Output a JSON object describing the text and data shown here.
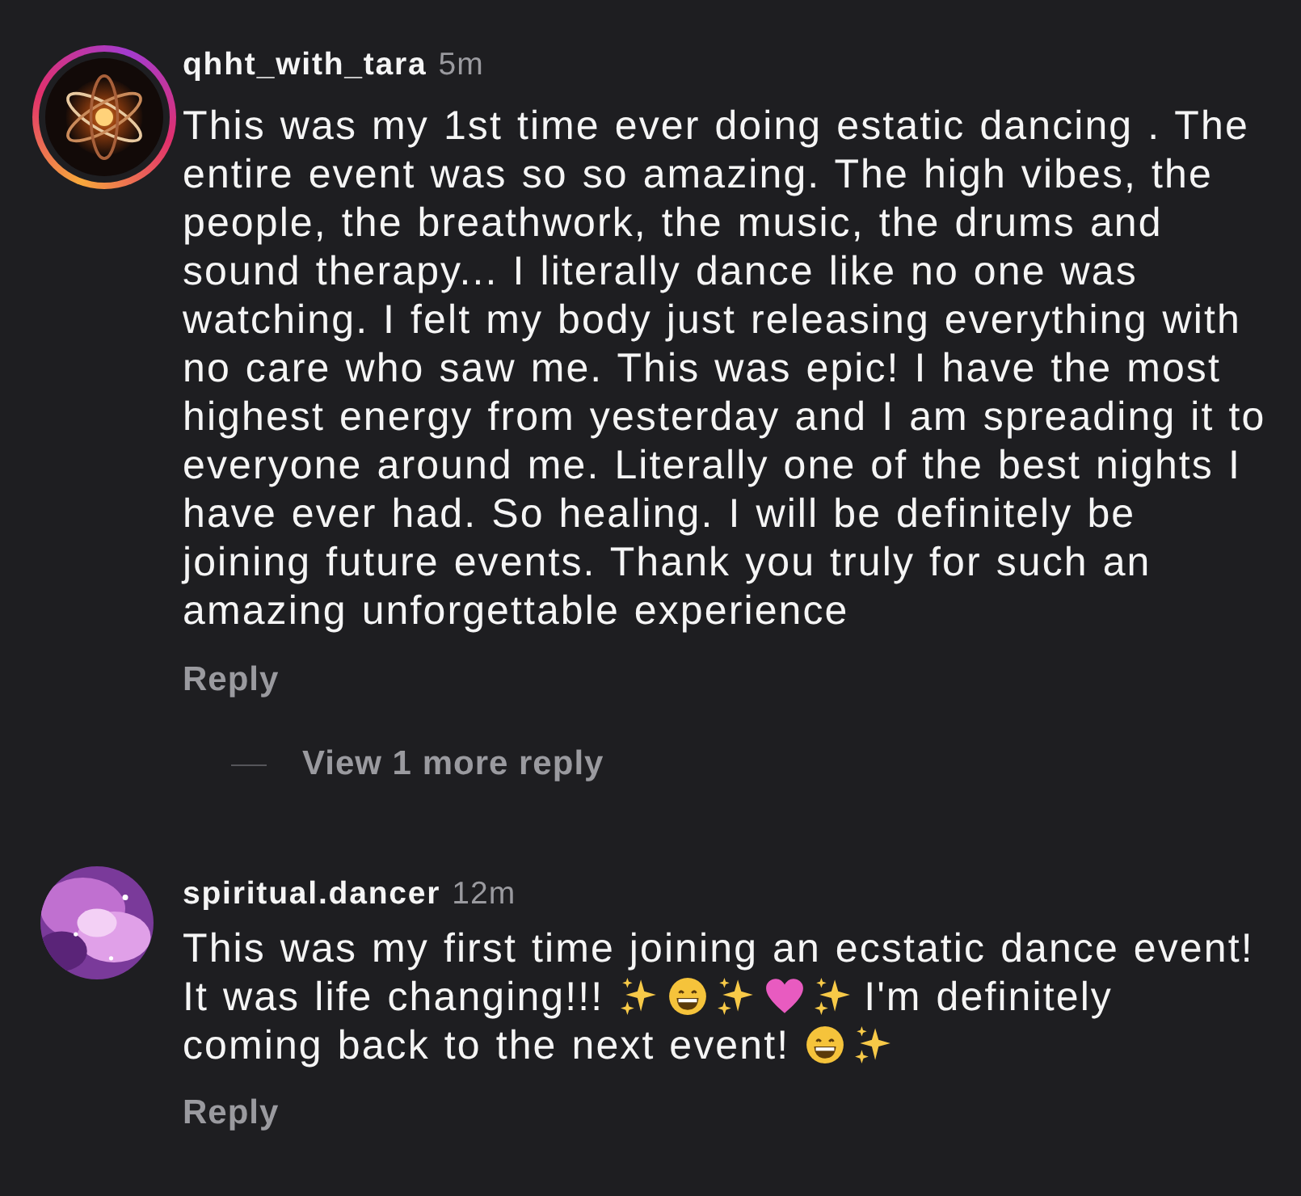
{
  "comments": [
    {
      "username": "qhht_with_tara",
      "time": "5m",
      "story_ring": true,
      "body": [
        {
          "kind": "text",
          "text": "This was my 1st time ever doing estatic dancing . The entire event was so so amazing. The high vibes, the people, the breathwork, the music, the drums and sound therapy... I literally dance like no one was watching. I felt my body just releasing everything with no care who saw me. This was epic! I have the most highest energy from yesterday and I am spreading it to everyone around me. Literally one of the best nights I have ever had. So healing. I will be definitely be joining future events. Thank you truly for such an amazing unforgettable experience"
        }
      ],
      "reply": "Reply",
      "more_replies": "View 1 more reply"
    },
    {
      "username": "spiritual.dancer",
      "time": "12m",
      "story_ring": false,
      "body": [
        {
          "kind": "text",
          "text": "This was my first time joining an ecstatic dance event!"
        },
        {
          "kind": "text",
          "text": "It was life changing!!!"
        },
        {
          "kind": "sparkles"
        },
        {
          "kind": "grin"
        },
        {
          "kind": "sparkles"
        },
        {
          "kind": "heart"
        },
        {
          "kind": "sparkles"
        },
        {
          "kind": "text",
          "text": "I'm definitely"
        },
        {
          "kind": "text",
          "text": "coming back to the next event!"
        },
        {
          "kind": "grin"
        },
        {
          "kind": "sparkles"
        }
      ],
      "reply": "Reply"
    }
  ]
}
